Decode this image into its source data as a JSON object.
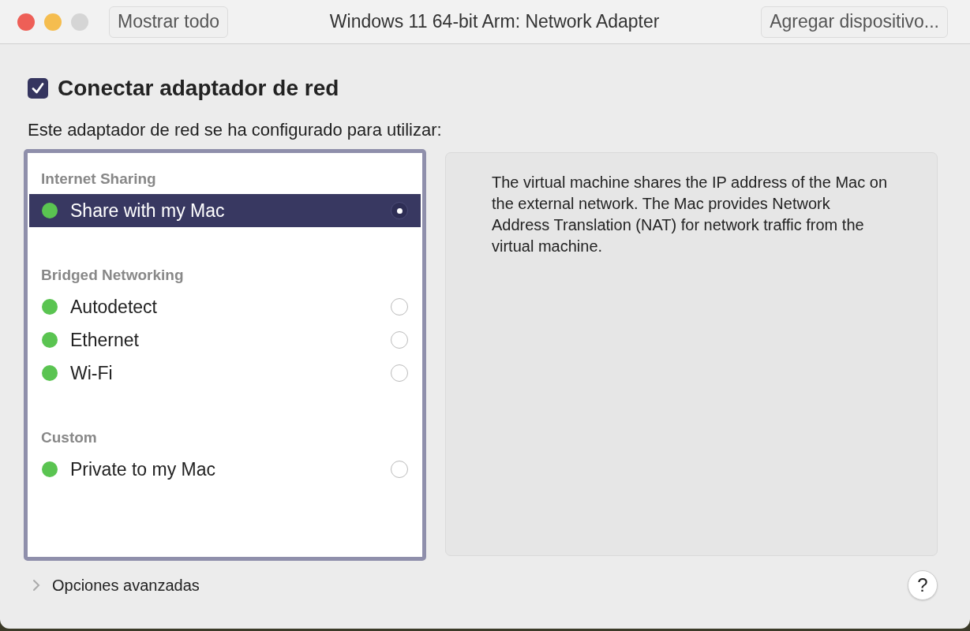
{
  "window": {
    "title": "Windows 11 64-bit Arm: Network Adapter"
  },
  "toolbar": {
    "show_all_button": "Mostrar todo",
    "add_device_button": "Agregar dispositivo..."
  },
  "connect": {
    "label": "Conectar adaptador de red",
    "checked": true
  },
  "intro": "Este adaptador de red se ha configurado para utilizar:",
  "groups": [
    {
      "header": "Internet Sharing",
      "items": [
        {
          "name": "Share with my Mac",
          "selected": true,
          "color": "#5ac451"
        }
      ]
    },
    {
      "header": "Bridged Networking",
      "items": [
        {
          "name": "Autodetect",
          "selected": false,
          "color": "#5ac451"
        },
        {
          "name": "Ethernet",
          "selected": false,
          "color": "#5ac451"
        },
        {
          "name": "Wi-Fi",
          "selected": false,
          "color": "#5ac451"
        }
      ]
    },
    {
      "header": "Custom",
      "items": [
        {
          "name": "Private to my Mac",
          "selected": false,
          "color": "#5ac451"
        }
      ]
    }
  ],
  "description": "The virtual machine shares the IP address of the Mac on the external network. The Mac provides Network Address Translation (NAT) for network traffic from the virtual machine.",
  "advanced": {
    "label": "Opciones avanzadas",
    "expanded": false
  },
  "help_button": "?"
}
